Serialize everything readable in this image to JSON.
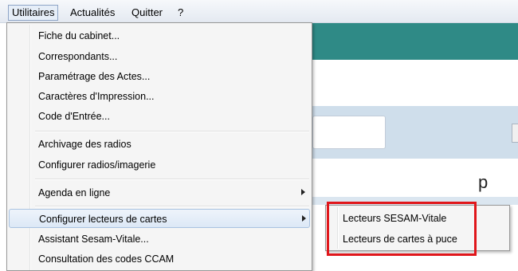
{
  "menubar": {
    "items": [
      {
        "label": "Utilitaires"
      },
      {
        "label": "Actualités"
      },
      {
        "label": "Quitter"
      },
      {
        "label": "?"
      }
    ]
  },
  "background": {
    "partial_text": "p"
  },
  "dropdown": {
    "items": [
      {
        "label": "Fiche du cabinet..."
      },
      {
        "label": "Correspondants..."
      },
      {
        "label": "Paramétrage des Actes..."
      },
      {
        "label": "Caractères d'Impression..."
      },
      {
        "label": "Code d'Entrée..."
      },
      {
        "label": "Archivage des radios"
      },
      {
        "label": "Configurer radios/imagerie"
      },
      {
        "label": "Agenda en ligne"
      },
      {
        "label": "Configurer lecteurs de cartes"
      },
      {
        "label": "Assistant Sesam-Vitale..."
      },
      {
        "label": "Consultation des codes CCAM"
      }
    ]
  },
  "submenu": {
    "items": [
      {
        "label": "Lecteurs SESAM-Vitale"
      },
      {
        "label": "Lecteurs de cartes à puce"
      }
    ]
  },
  "colors": {
    "highlight_box": "#e0161b",
    "teal_header": "#2f8a86"
  }
}
